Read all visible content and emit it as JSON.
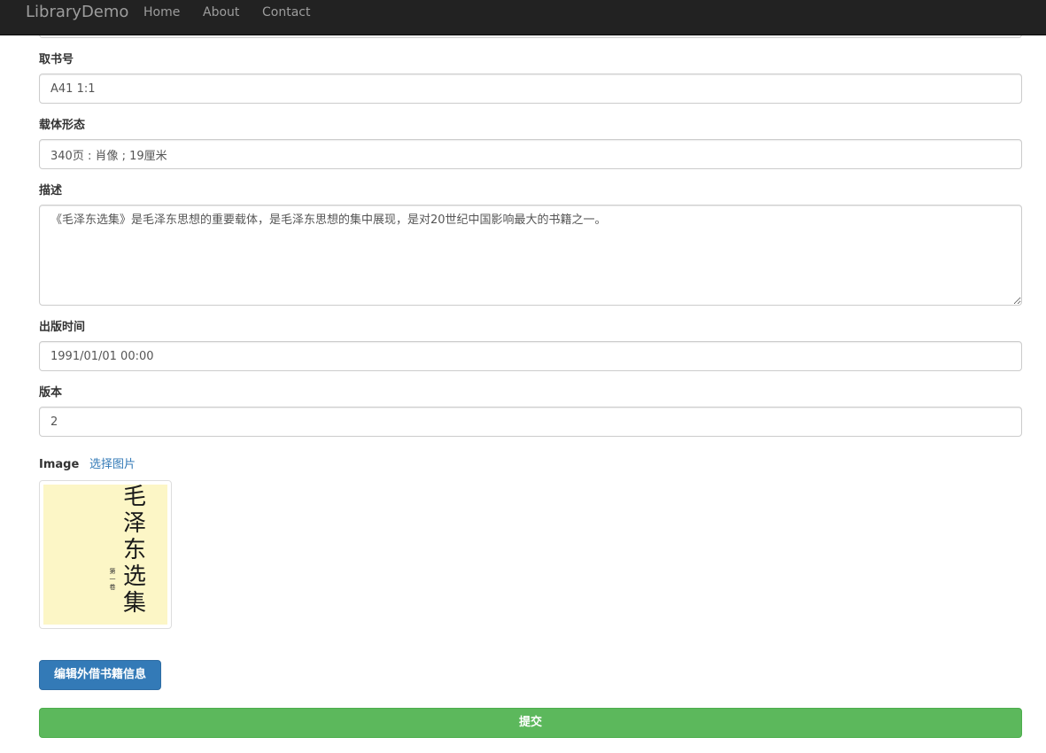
{
  "navbar": {
    "brand": "LibraryDemo",
    "links": [
      "Home",
      "About",
      "Contact"
    ]
  },
  "form": {
    "call_number": {
      "label": "取书号",
      "value": "A41 1:1"
    },
    "physical_description": {
      "label": "载体形态",
      "value": "340页 : 肖像 ; 19厘米"
    },
    "description": {
      "label": "描述",
      "value": "《毛泽东选集》是毛泽东思想的重要载体，是毛泽东思想的集中展现，是对20世纪中国影响最大的书籍之一。"
    },
    "publish_date": {
      "label": "出版时间",
      "value": "1991/01/01 00:00"
    },
    "edition": {
      "label": "版本",
      "value": "2"
    },
    "image": {
      "label": "Image",
      "choose_link": "选择图片",
      "cover_title": "毛泽东选集",
      "cover_subtitle": "第一卷"
    }
  },
  "buttons": {
    "edit": "编辑外借书籍信息",
    "submit": "提交"
  },
  "colors": {
    "navbar_bg": "#222222",
    "primary": "#337ab7",
    "success": "#5cb85c",
    "cover_bg": "#fcf6c6"
  }
}
